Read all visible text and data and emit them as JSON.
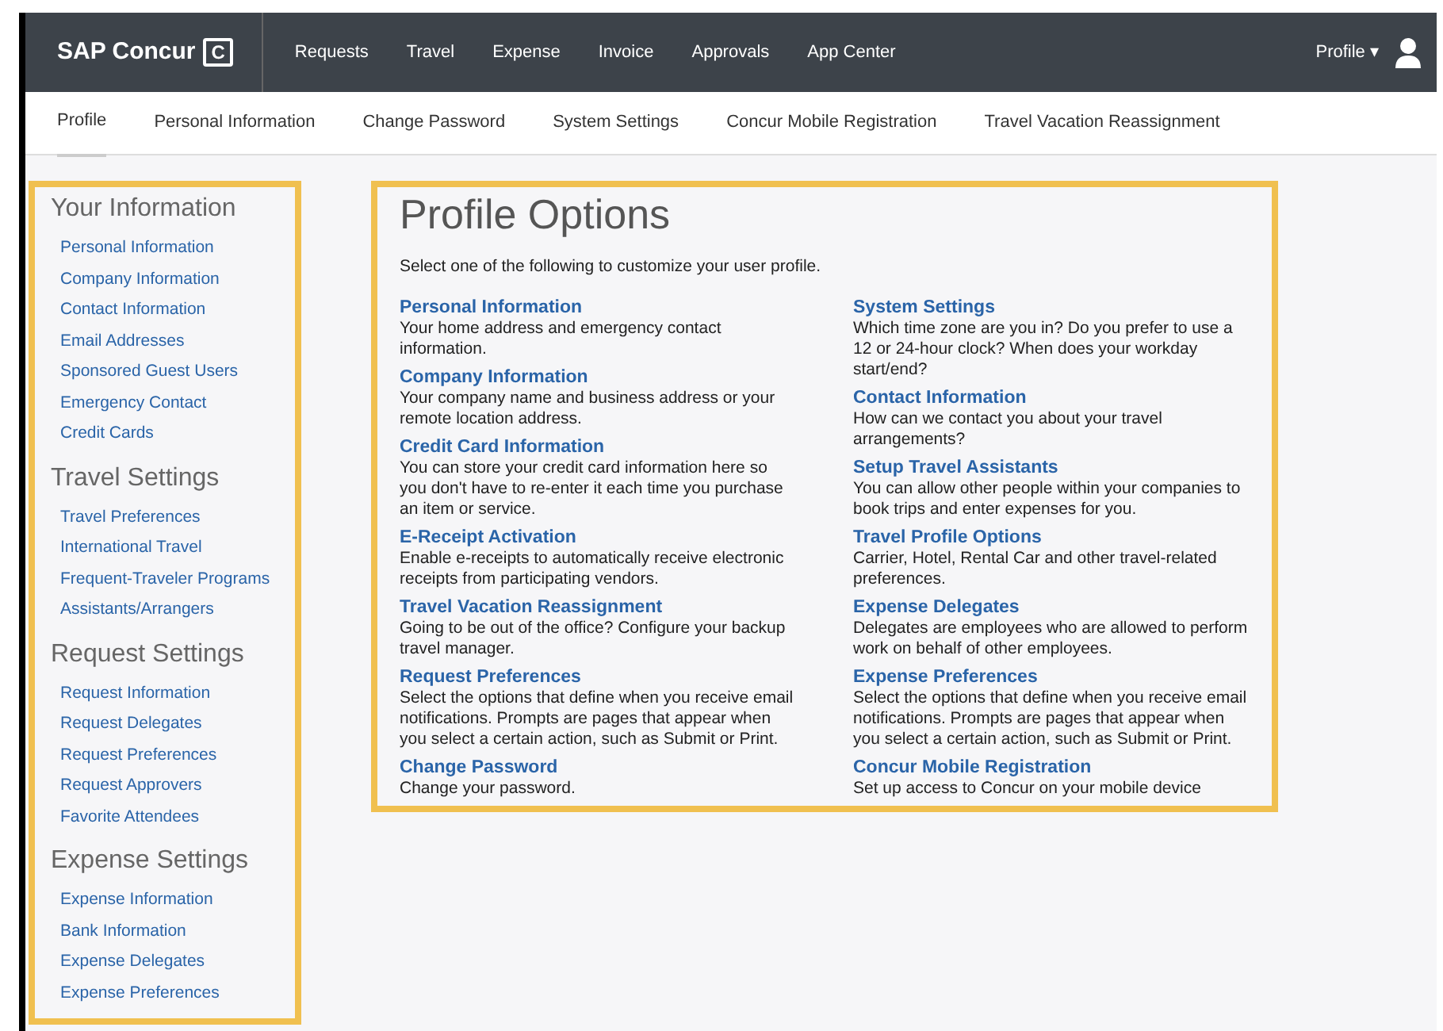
{
  "navbar": {
    "brand": "SAP Concur",
    "brand_mark": "C",
    "items": [
      {
        "label": "Requests"
      },
      {
        "label": "Travel"
      },
      {
        "label": "Expense"
      },
      {
        "label": "Invoice"
      },
      {
        "label": "Approvals"
      },
      {
        "label": "App Center"
      }
    ],
    "profile": "Profile ▾"
  },
  "subnav": [
    {
      "label": "Profile",
      "selected": true
    },
    {
      "label": "Personal Information",
      "selected": false
    },
    {
      "label": "Change Password",
      "selected": false
    },
    {
      "label": "System Settings",
      "selected": false
    },
    {
      "label": "Concur Mobile Registration",
      "selected": false
    },
    {
      "label": "Travel Vacation Reassignment",
      "selected": false
    }
  ],
  "sidebar": [
    {
      "heading": "Your Information",
      "links": [
        "Personal Information",
        "Company Information",
        "Contact Information",
        "Email Addresses",
        "Sponsored Guest Users",
        "Emergency Contact",
        "Credit Cards"
      ]
    },
    {
      "heading": "Travel Settings",
      "links": [
        "Travel Preferences",
        "International Travel",
        "Frequent-Traveler Programs",
        "Assistants/Arrangers"
      ]
    },
    {
      "heading": "Request Settings",
      "links": [
        "Request Information",
        "Request Delegates",
        "Request Preferences",
        "Request Approvers",
        "Favorite Attendees"
      ]
    },
    {
      "heading": "Expense Settings",
      "links": [
        "Expense Information",
        "Bank Information",
        "Expense Delegates",
        "Expense Preferences"
      ]
    }
  ],
  "main": {
    "title": "Profile Options",
    "intro": "Select one of the following to customize your user profile.",
    "columns": [
      [
        {
          "title": "Personal Information",
          "text": "Your home address and emergency contact information."
        },
        {
          "title": "Company Information",
          "text": "Your company name and business address or your remote location address."
        },
        {
          "title": "Credit Card Information",
          "text": "You can store your credit card information here so you don't have to re-enter it each time you purchase an item or service."
        },
        {
          "title": "E-Receipt Activation",
          "text": "Enable e-receipts to automatically receive electronic receipts from participating vendors."
        },
        {
          "title": "Travel Vacation Reassignment",
          "text": "Going to be out of the office? Configure your backup travel manager."
        },
        {
          "title": "Request Preferences",
          "text": "Select the options that define when you receive email notifications. Prompts are pages that appear when you select a certain action, such as Submit or Print."
        },
        {
          "title": "Change Password",
          "text": "Change your password."
        }
      ],
      [
        {
          "title": "System Settings",
          "text": "Which time zone are you in? Do you prefer to use a 12 or 24-hour clock? When does your workday start/end?"
        },
        {
          "title": "Contact Information",
          "text": "How can we contact you about your travel arrangements?"
        },
        {
          "title": "Setup Travel Assistants",
          "text": "You can allow other people within your companies to book trips and enter expenses for you."
        },
        {
          "title": "Travel Profile Options",
          "text": "Carrier, Hotel, Rental Car and other travel-related preferences."
        },
        {
          "title": "Expense Delegates",
          "text": "Delegates are employees who are allowed to perform work on behalf of other employees."
        },
        {
          "title": "Expense Preferences",
          "text": "Select the options that define when you receive email notifications. Prompts are pages that appear when you select a certain action, such as Submit or Print."
        },
        {
          "title": "Concur Mobile Registration",
          "text": "Set up access to Concur on your mobile device"
        }
      ]
    ]
  }
}
